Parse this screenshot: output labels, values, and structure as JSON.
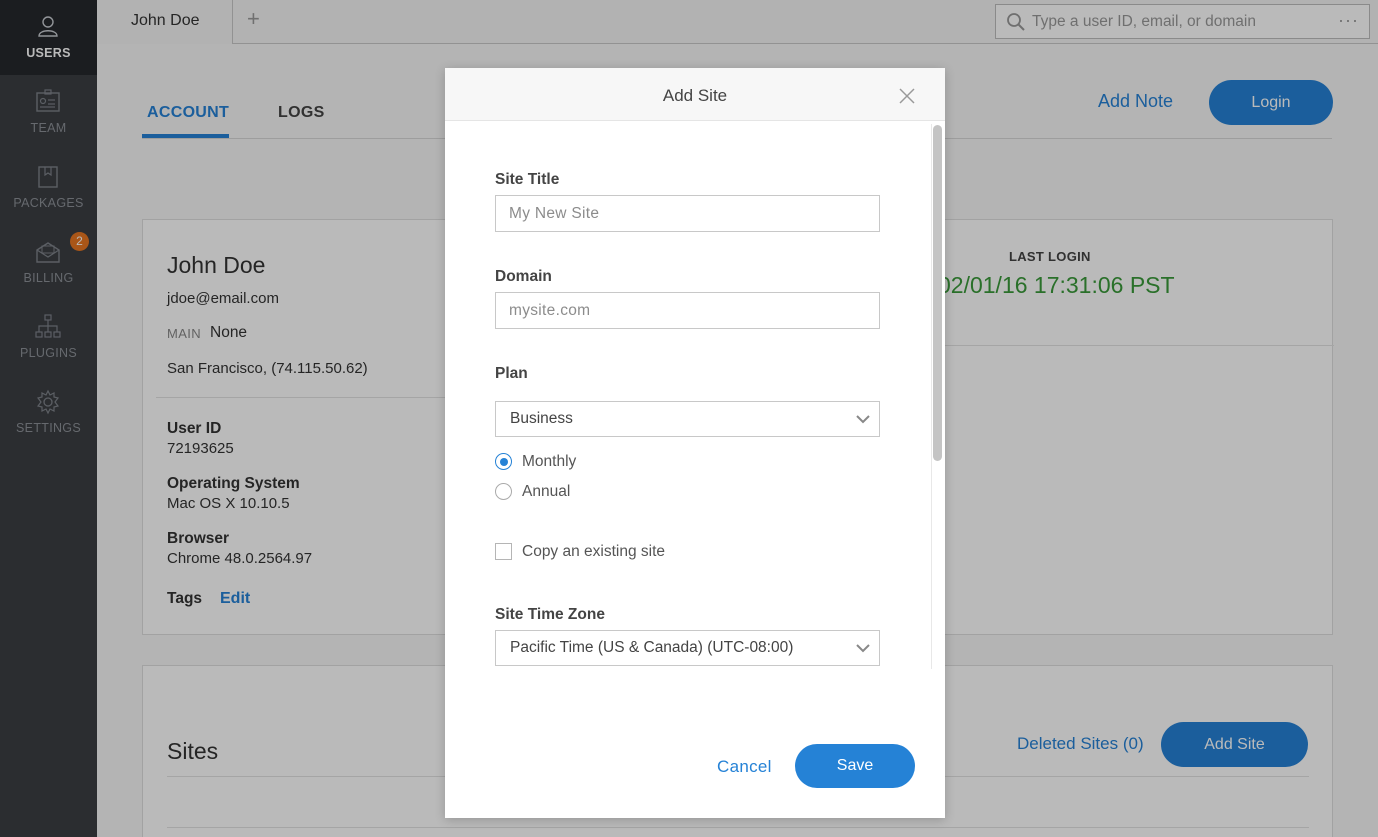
{
  "sidebar": {
    "items": [
      {
        "label": "USERS",
        "icon": "user-icon",
        "active": true
      },
      {
        "label": "TEAM",
        "icon": "id-card-icon"
      },
      {
        "label": "PACKAGES",
        "icon": "package-icon"
      },
      {
        "label": "BILLING",
        "icon": "envelope-icon",
        "badge": "2"
      },
      {
        "label": "PLUGINS",
        "icon": "plugins-icon"
      },
      {
        "label": "SETTINGS",
        "icon": "gear-icon"
      }
    ]
  },
  "topbar": {
    "tab_label": "John Doe",
    "new_tab_symbol": "+",
    "search_placeholder": "Type a user ID, email, or domain",
    "search_menu": "···"
  },
  "tabs": {
    "account": "ACCOUNT",
    "logs": "LOGS"
  },
  "header_actions": {
    "add_note": "Add Note",
    "login": "Login"
  },
  "profile": {
    "name": "John Doe",
    "email": "jdoe@email.com",
    "main_label": "MAIN",
    "main_value": "None",
    "location": "San Francisco, (74.115.50.62)",
    "user_id_label": "User ID",
    "user_id": "72193625",
    "os_label": "Operating System",
    "os": "Mac OS X 10.10.5",
    "browser_label": "Browser",
    "browser": "Chrome 48.0.2564.97",
    "tags_label": "Tags",
    "tags_edit": "Edit",
    "last_login_label": "LAST LOGIN",
    "last_login_value": "02/01/16 17:31:06 PST"
  },
  "sites": {
    "title": "Sites",
    "deleted": "Deleted Sites (0)",
    "add_button": "Add Site"
  },
  "modal": {
    "title": "Add Site",
    "site_title_label": "Site Title",
    "site_title_placeholder": "My New Site",
    "domain_label": "Domain",
    "domain_placeholder": "mysite.com",
    "plan_label": "Plan",
    "plan_value": "Business",
    "billing_monthly": "Monthly",
    "billing_annual": "Annual",
    "billing_selected": "Monthly",
    "copy_site_label": "Copy an existing site",
    "copy_site_checked": false,
    "timezone_label": "Site Time Zone",
    "timezone_value": "Pacific Time (US & Canada) (UTC-08:00)",
    "cancel": "Cancel",
    "save": "Save"
  },
  "colors": {
    "accent": "#2582d6",
    "sidebar_bg": "#3b3e43",
    "sidebar_active_bg": "#26282c",
    "badge": "#e87722",
    "last_login": "#3a9a3a"
  }
}
